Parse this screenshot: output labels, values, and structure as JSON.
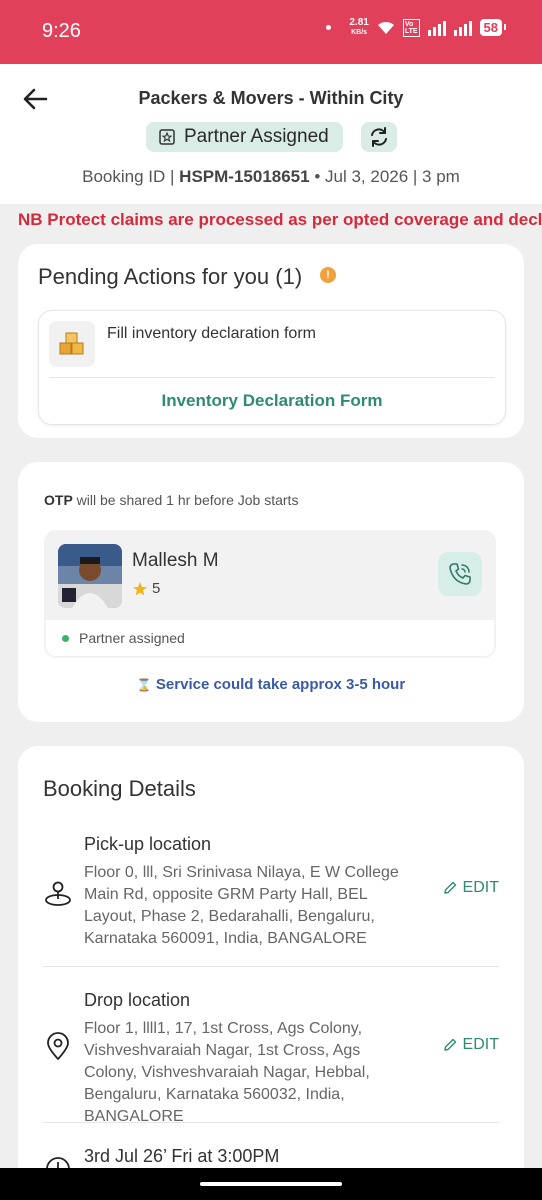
{
  "status_bar": {
    "time": "9:26",
    "speed_value": "2.81",
    "speed_unit": "KB/s",
    "volte": "Vo LTE 2",
    "battery": "58"
  },
  "header": {
    "title": "Packers & Movers - Within City",
    "status": "Partner Assigned",
    "booking_label": "Booking ID |",
    "booking_id": "HSPM-15018651",
    "schedule": "Jul 3, 2026 | 3 pm"
  },
  "marquee": "NB Protect claims are processed as per opted coverage and decla",
  "pending": {
    "title": "Pending Actions for you (1)",
    "alert": "!",
    "action_text": "Fill inventory declaration form",
    "action_link": "Inventory Declaration Form"
  },
  "partner": {
    "otp_bold": "OTP",
    "otp_rest": "will be shared 1 hr before Job starts",
    "name": "Mallesh M",
    "rating": "5",
    "status": "Partner assigned",
    "service_note": "Service could take approx 3-5 hour"
  },
  "details": {
    "title": "Booking Details",
    "pickup": {
      "label": "Pick-up location",
      "address": "Floor 0, lll, Sri Srinivasa Nilaya, E W College Main Rd, opposite GRM Party Hall, BEL Layout, Phase 2, Bedarahalli, Bengaluru, Karnataka 560091, India, BANGALORE",
      "edit": "EDIT"
    },
    "drop": {
      "label": "Drop location",
      "address": "Floor 1, llll1, 17, 1st Cross, Ags Colony, Vishveshvaraiah Nagar, 1st Cross, Ags Colony, Vishveshvaraiah Nagar, Hebbal, Bengaluru, Karnataka 560032, India, BANGALORE",
      "edit": "EDIT"
    },
    "date": "3rd Jul 26’ Fri at 3:00PM"
  },
  "colors": {
    "status_bar": "#e0405a",
    "accent_green": "#2f8a74",
    "alert_red": "#d42a3c"
  }
}
